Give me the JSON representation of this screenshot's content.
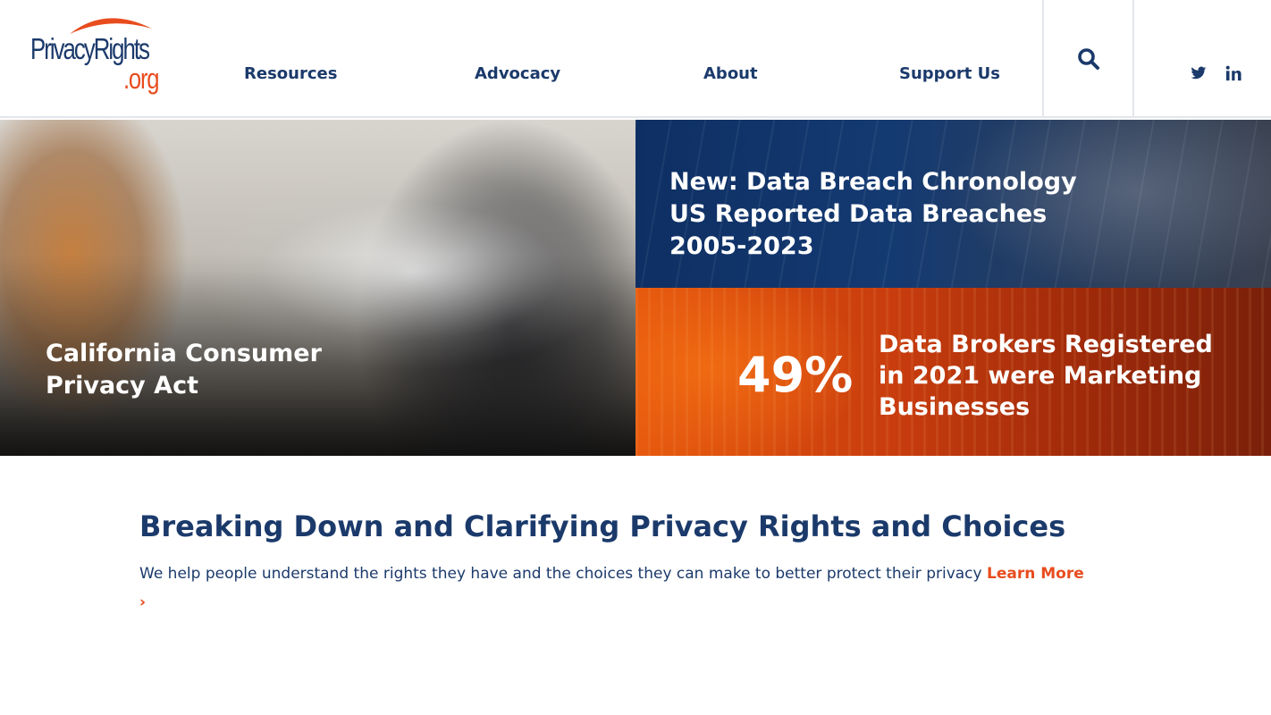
{
  "brand": {
    "logo_word": "PrivacyRights",
    "logo_tld": ".org",
    "navy": "#1b3a6b",
    "orange": "#e84c1e"
  },
  "nav": {
    "items": [
      {
        "label": "Resources"
      },
      {
        "label": "Advocacy"
      },
      {
        "label": "About"
      },
      {
        "label": "Support Us"
      }
    ],
    "search_icon": "search-icon",
    "social": [
      "twitter-icon",
      "linkedin-icon"
    ]
  },
  "hero": {
    "ccpa": {
      "title": "California Consumer Privacy Act"
    },
    "breach": {
      "title": "New: Data Breach Chronology US Reported Data Breaches 2005-2023"
    },
    "brokers": {
      "stat": "49%",
      "title": "Data Brokers Registered in 2021 were Marketing Businesses"
    }
  },
  "intro": {
    "heading": "Breaking Down and Clarifying Privacy Rights and Choices",
    "text": "We help people understand the rights they have and the choices they can make to better protect their privacy",
    "link_label": "Learn More",
    "link_chevron": "›"
  }
}
